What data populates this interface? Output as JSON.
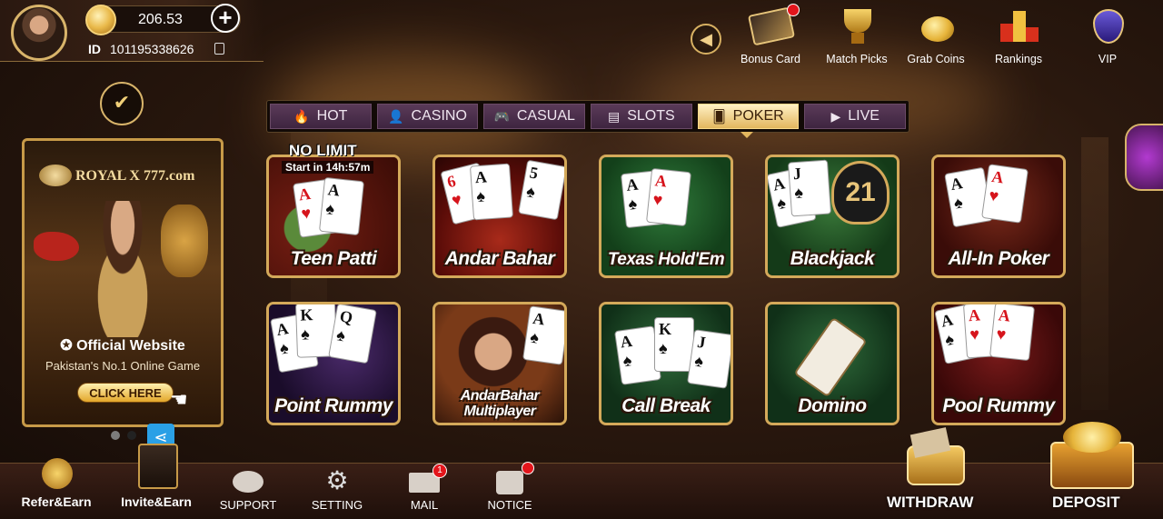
{
  "profile": {
    "balance": "206.53",
    "id_label": "ID",
    "id_value": "101195338626"
  },
  "top_menu": {
    "items": [
      {
        "label": "Bonus Card",
        "badge": true
      },
      {
        "label": "Match Picks",
        "badge": false
      },
      {
        "label": "Grab Coins",
        "badge": false
      },
      {
        "label": "Rankings",
        "badge": false
      },
      {
        "label": "VIP",
        "badge": false
      }
    ]
  },
  "tabs": [
    {
      "label": "HOT",
      "icon": "flame-icon",
      "active": false
    },
    {
      "label": "CASINO",
      "icon": "user-icon",
      "active": false
    },
    {
      "label": "CASUAL",
      "icon": "gamepad-icon",
      "active": false
    },
    {
      "label": "SLOTS",
      "icon": "slot-machine-icon",
      "active": false
    },
    {
      "label": "POKER",
      "icon": "card-icon",
      "active": true
    },
    {
      "label": "LIVE",
      "icon": "video-icon",
      "active": false
    }
  ],
  "banner": {
    "logo": "ROYAL X 777.com",
    "official": "Official Website",
    "subtitle": "Pakistan's No.1 Online Game",
    "cta": "CLICK HERE"
  },
  "promo": {
    "title": "NO LIMIT",
    "countdown": "Start in 14h:57m"
  },
  "games": [
    {
      "name": "Teen Patti"
    },
    {
      "name": "Andar Bahar"
    },
    {
      "name": "Texas Hold'Em"
    },
    {
      "name": "Blackjack"
    },
    {
      "name": "All-In Poker"
    },
    {
      "name": "Point Rummy"
    },
    {
      "name": "AndarBahar Multiplayer"
    },
    {
      "name": "Call Break"
    },
    {
      "name": "Domino"
    },
    {
      "name": "Pool Rummy"
    }
  ],
  "bottom_nav": {
    "refer": "Refer&Earn",
    "invite": "Invite&Earn",
    "support": "SUPPORT",
    "setting": "SETTING",
    "mail": "MAIL",
    "mail_badge": "1",
    "notice": "NOTICE",
    "withdraw": "WITHDRAW",
    "deposit": "DEPOSIT"
  },
  "colors": {
    "gold": "#d4a95a",
    "tab_active": "#e2b65e",
    "tab_inactive": "#4a2e4a",
    "badge_red": "#e3151b"
  }
}
